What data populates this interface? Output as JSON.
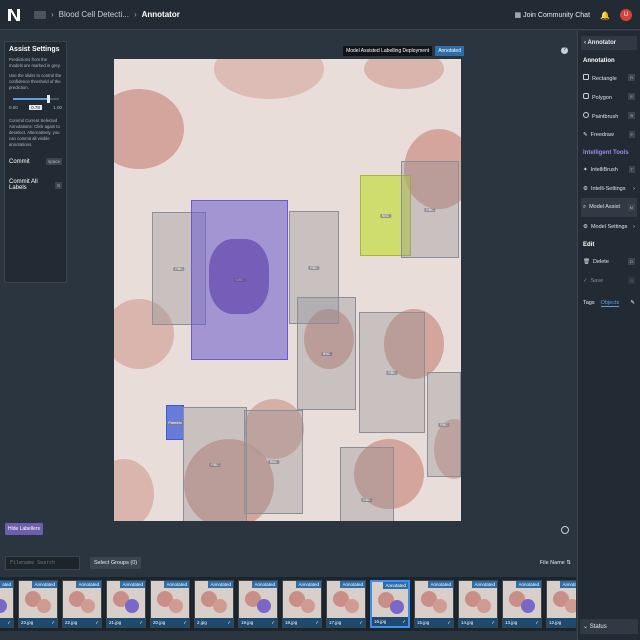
{
  "topbar": {
    "crumbs": [
      "Blood Cell Detecti...",
      "Annotator"
    ],
    "community": "Join Community Chat",
    "avatar": "U"
  },
  "assist": {
    "title": "Assist Settings",
    "text1": "Predictions from the models are marked in grey.",
    "text2": "Use the slider to control the confidence threshold of the prediction.",
    "slider_min": "0.00",
    "slider_val": "0.78",
    "slider_max": "1.00",
    "slider_fraction": 0.78,
    "text3": "Commit Current Selected Annotations: Click again to deselect. Alternatively, you can commit all visible annotations.",
    "commit": "Commit",
    "commit_key": "space",
    "commit_all": "Commit All Labels",
    "commit_all_key": "S"
  },
  "mal": {
    "label": "Model Assisted Labelling Deployment",
    "badge": "Annotated"
  },
  "hide_labellers": "Hide Labellers",
  "boxes": [
    {
      "label": "RBC",
      "color": "#8a8f98",
      "fill": "rgba(140,140,150,0.35)"
    },
    {
      "label": "WBC",
      "color": "#6a5acd",
      "fill": "rgba(106,90,205,0.55)"
    },
    {
      "label": "RBC",
      "color": "#8a8f98",
      "fill": "rgba(140,140,150,0.35)"
    },
    {
      "label": "RBC",
      "color": "#aeb23a",
      "fill": "rgba(190,220,40,0.6)"
    },
    {
      "label": "RBC",
      "color": "#8a8f98",
      "fill": "rgba(140,140,150,0.35)"
    },
    {
      "label": "RBC",
      "color": "#8a8f98",
      "fill": "rgba(140,140,150,0.35)"
    },
    {
      "label": "RBC",
      "color": "#8a8f98",
      "fill": "rgba(140,140,150,0.35)"
    },
    {
      "label": "RBC",
      "color": "#8a8f98",
      "fill": "rgba(140,140,150,0.35)"
    },
    {
      "label": "Platelets",
      "color": "#3a5ad0",
      "fill": "rgba(60,90,220,0.75)"
    },
    {
      "label": "RBC",
      "color": "#8a8f98",
      "fill": "rgba(140,140,150,0.35)"
    },
    {
      "label": "RBC",
      "color": "#8a8f98",
      "fill": "rgba(140,140,150,0.35)"
    },
    {
      "label": "RBC",
      "color": "#8a8f98",
      "fill": "rgba(140,140,150,0.35)"
    }
  ],
  "panel": {
    "header": "Annotator",
    "annotation_title": "Annotation",
    "tools": [
      {
        "label": "Rectangle",
        "key": "R"
      },
      {
        "label": "Polygon",
        "key": "E"
      },
      {
        "label": "Paintbrush",
        "key": "B"
      },
      {
        "label": "Freedraw",
        "key": "F"
      }
    ],
    "intelligent_title": "Intelligent Tools",
    "intel": [
      {
        "label": "IntelliBrush",
        "key": "T"
      },
      {
        "label": "Intelli-Settings",
        "key": "›"
      },
      {
        "label": "Model Assist",
        "key": "M"
      },
      {
        "label": "Model Settings",
        "key": "›"
      }
    ],
    "edit_title": "Edit",
    "edit": [
      {
        "label": "Delete",
        "key": "D"
      },
      {
        "label": "Save",
        "key": "S"
      }
    ],
    "tabs": [
      "Tags",
      "Objects"
    ],
    "status": "Status"
  },
  "bottom": {
    "filename_placeholder": "Filename Search",
    "select_groups": "Select Groups (0)",
    "sort": "File Name"
  },
  "thumbs": [
    {
      "name": "",
      "badge": "ated"
    },
    {
      "name": "23.jpg",
      "badge": "Annotated"
    },
    {
      "name": "22.jpg",
      "badge": "Annotated"
    },
    {
      "name": "21.jpg",
      "badge": "Annotated"
    },
    {
      "name": "20.jpg",
      "badge": "Annotated"
    },
    {
      "name": "2.jpg",
      "badge": "Annotated"
    },
    {
      "name": "19.jpg",
      "badge": "Annotated"
    },
    {
      "name": "18.jpg",
      "badge": "Annotated"
    },
    {
      "name": "17.jpg",
      "badge": "Annotated"
    },
    {
      "name": "16.jpg",
      "badge": "Annotated"
    },
    {
      "name": "15.jpg",
      "badge": "Annotated"
    },
    {
      "name": "14.jpg",
      "badge": "Annotated"
    },
    {
      "name": "13.jpg",
      "badge": "Annotated"
    },
    {
      "name": "12.jpg",
      "badge": "Annotated"
    }
  ]
}
